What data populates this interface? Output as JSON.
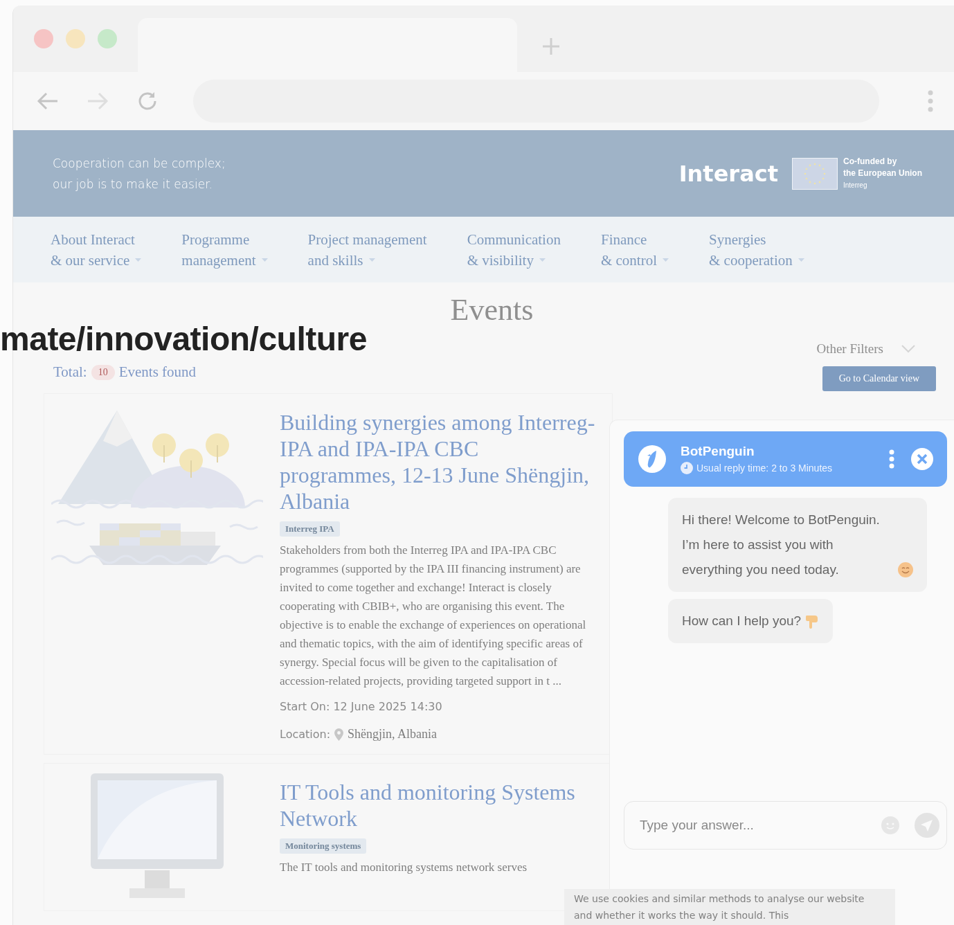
{
  "banner": {
    "tagline": [
      "Cooperation can be complex;",
      "our job is to make it easier."
    ],
    "logo": "Interact",
    "funding": [
      "Co-funded by",
      "the European Union"
    ],
    "funding_sub": "Interreg"
  },
  "nav": [
    {
      "line1": "About Interact",
      "line2": "& our service"
    },
    {
      "line1": "Programme",
      "line2": "management"
    },
    {
      "line1": "Project management",
      "line2": "and skills"
    },
    {
      "line1": "Communication",
      "line2": "& visibility"
    },
    {
      "line1": "Finance",
      "line2": "& control"
    },
    {
      "line1": "Synergies",
      "line2": "& cooperation"
    }
  ],
  "overlay_text": "mate/innovation/culture",
  "page_title": "Events",
  "filters": {
    "label": "Other Filters",
    "calendar_button": "Go to Calendar view"
  },
  "total": {
    "label": "Total:",
    "count": "10",
    "suffix": "Events found"
  },
  "events": [
    {
      "kind": "landscape",
      "title": "Building synergies among Interreg-IPA and IPA-IPA CBC programmes, 12-13 June Shëngjin, Albania",
      "tag": "Interreg IPA",
      "description": "Stakeholders from both the Interreg IPA and IPA-IPA CBC programmes (supported by the IPA III financing instrument) are invited to come together and exchange! Interact is closely cooperating with CBIB+, who are organising this event. The objective is to enable the exchange of experiences on operational and thematic topics, with the aim of identifying specific areas of synergy. Special focus will be given to the capitalisation of accession-related projects, providing targeted support in t ...",
      "start": "Start On: 12 June 2025 14:30",
      "location_label": "Location:",
      "location": "Shëngjin, Albania"
    },
    {
      "kind": "monitor",
      "title": "IT Tools and monitoring Systems Network",
      "tag": "Monitoring systems",
      "description": "The IT tools and monitoring systems network serves"
    }
  ],
  "chat": {
    "name": "BotPenguin",
    "reply_time": "Usual reply time: 2 to 3 Minutes",
    "messages": [
      {
        "text": "Hi there! Welcome to BotPenguin. I’m here to assist you with everything you need today.",
        "kind": "greeting"
      },
      {
        "text": "How can I help you?",
        "kind": "question"
      }
    ],
    "placeholder": "Type your answer..."
  },
  "cookie_notice": "We use cookies and similar methods to analyse our website and whether it works the way it should. This"
}
